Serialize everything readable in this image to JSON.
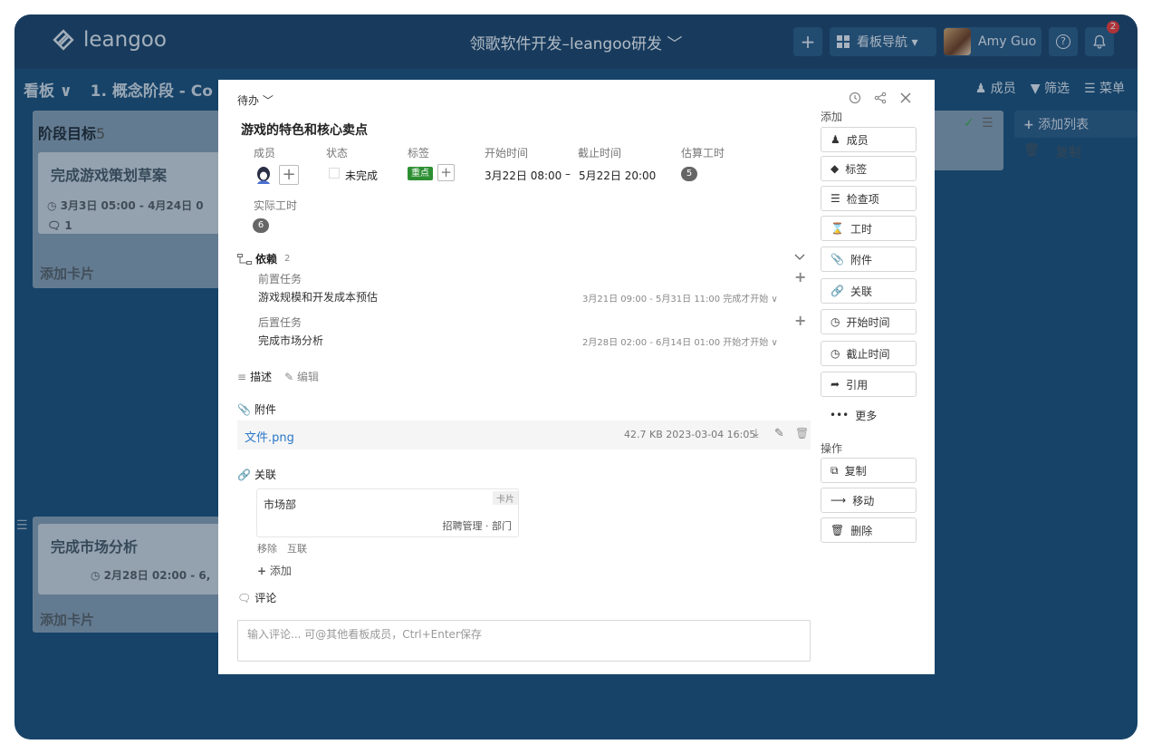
{
  "app": {
    "logo_text": "leangoo",
    "board_title": "领歌软件开发–leangoo研发 ﹀"
  },
  "topbar": {
    "plus": "+",
    "nav_label": "看板导航 ▾",
    "user_name": "Amy Guo",
    "help": "?",
    "notif_count": "2"
  },
  "subbar": {
    "board_menu": "看板 ∨",
    "stage_title": "1. 概念阶段 - Co",
    "members": "成员",
    "filter": "筛选",
    "menu": "菜单"
  },
  "board": {
    "col1_title": "阶段目标",
    "col1_count": "5",
    "card1_title": "完成游戏策划草案",
    "card1_time": "3月3日 05:00 - 4月24日 0",
    "card1_comments": "1",
    "add_card": "添加卡片",
    "card2_title": "完成市场分析",
    "card2_time": "2月28日 02:00 - 6,",
    "add_list": "添加列表",
    "copy": "复制"
  },
  "modal": {
    "status": "待办 ﹀",
    "title": "游戏的特色和核心卖点",
    "labels": {
      "member": "成员",
      "state": "状态",
      "tags": "标签",
      "start": "开始时间",
      "end": "截止时间",
      "estimate": "估算工时",
      "actual": "实际工时"
    },
    "state_value": "未完成",
    "tag_value": "重点",
    "start_value": "3月22日 08:00",
    "dash": "–",
    "end_value": "5月22日 20:00",
    "estimate_value": "5",
    "actual_value": "6",
    "deps": {
      "title": "依赖",
      "count": "2",
      "pre_label": "前置任务",
      "pre_task": "游戏规模和开发成本预估",
      "pre_meta": "3月21日 09:00 - 5月31日 11:00  完成才开始 ∨",
      "post_label": "后置任务",
      "post_task": "完成市场分析",
      "post_meta": "2月28日 02:00 - 6月14日 01:00  开始才开始 ∨"
    },
    "desc": {
      "title": "描述",
      "edit": "编辑"
    },
    "attachments": {
      "title": "附件",
      "file_name": "文件.png",
      "file_meta": "42.7 KB  2023-03-04 16:05"
    },
    "links": {
      "title": "关联",
      "item_name": "市场部",
      "item_type": "卡片",
      "item_path": "招聘管理 · 部门",
      "remove": "移除",
      "mutual": "互联",
      "add": "添加"
    },
    "comments": {
      "title": "评论",
      "placeholder": "输入评论... 可@其他看板成员，Ctrl+Enter保存"
    },
    "side": {
      "add_heading": "添加",
      "btn_member": "成员",
      "btn_tag": "标签",
      "btn_check": "检查项",
      "btn_hours": "工时",
      "btn_attach": "附件",
      "btn_link": "关联",
      "btn_start": "开始时间",
      "btn_end": "截止时间",
      "btn_quote": "引用",
      "btn_more": "更多",
      "ops_heading": "操作",
      "btn_copy": "复制",
      "btn_move": "移动",
      "btn_delete": "删除"
    }
  }
}
